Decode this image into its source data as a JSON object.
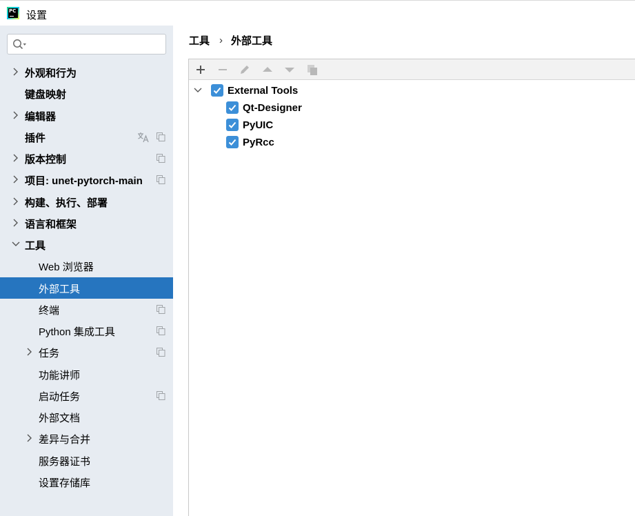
{
  "window": {
    "title": "设置",
    "logo_text": "PC"
  },
  "search": {
    "placeholder": "",
    "value": ""
  },
  "sidebar": {
    "items": [
      {
        "label": "外观和行为",
        "level": 0,
        "expandable": true
      },
      {
        "label": "键盘映射",
        "level": 0,
        "expandable": false
      },
      {
        "label": "编辑器",
        "level": 0,
        "expandable": true
      },
      {
        "label": "插件",
        "level": 0,
        "expandable": false
      },
      {
        "label": "版本控制",
        "level": 0,
        "expandable": true
      },
      {
        "label": "项目: unet-pytorch-main",
        "level": 0,
        "expandable": true
      },
      {
        "label": "构建、执行、部署",
        "level": 0,
        "expandable": true
      },
      {
        "label": "语言和框架",
        "level": 0,
        "expandable": true
      },
      {
        "label": "工具",
        "level": 0,
        "expandable": true,
        "expanded": true
      },
      {
        "label": "Web 浏览器",
        "level": 1,
        "expandable": false
      },
      {
        "label": "外部工具",
        "level": 1,
        "expandable": false,
        "selected": true
      },
      {
        "label": "终端",
        "level": 1,
        "expandable": false
      },
      {
        "label": "Python 集成工具",
        "level": 1,
        "expandable": false
      },
      {
        "label": "任务",
        "level": 1,
        "expandable": true
      },
      {
        "label": "功能讲师",
        "level": 1,
        "expandable": false
      },
      {
        "label": "启动任务",
        "level": 1,
        "expandable": false
      },
      {
        "label": "外部文档",
        "level": 1,
        "expandable": false
      },
      {
        "label": "差异与合并",
        "level": 1,
        "expandable": true
      },
      {
        "label": "服务器证书",
        "level": 1,
        "expandable": false
      },
      {
        "label": "设置存储库",
        "level": 1,
        "expandable": false
      }
    ]
  },
  "breadcrumb": {
    "parent": "工具",
    "separator": "›",
    "current": "外部工具"
  },
  "toolbar": {
    "buttons": [
      "add-icon",
      "remove-icon",
      "edit-icon",
      "move-up-icon",
      "move-down-icon",
      "copy-icon"
    ]
  },
  "tree": {
    "group": {
      "label": "External Tools",
      "checked": true,
      "expanded": true
    },
    "tools": [
      {
        "label": "Qt-Designer",
        "checked": true
      },
      {
        "label": "PyUIC",
        "checked": true
      },
      {
        "label": "PyRcc",
        "checked": true
      }
    ]
  },
  "colors": {
    "sidebar_bg": "#e7ecf2",
    "selection": "#2675bf",
    "checkbox": "#3c8fd8",
    "toolbar_bg": "#f2f2f2"
  }
}
